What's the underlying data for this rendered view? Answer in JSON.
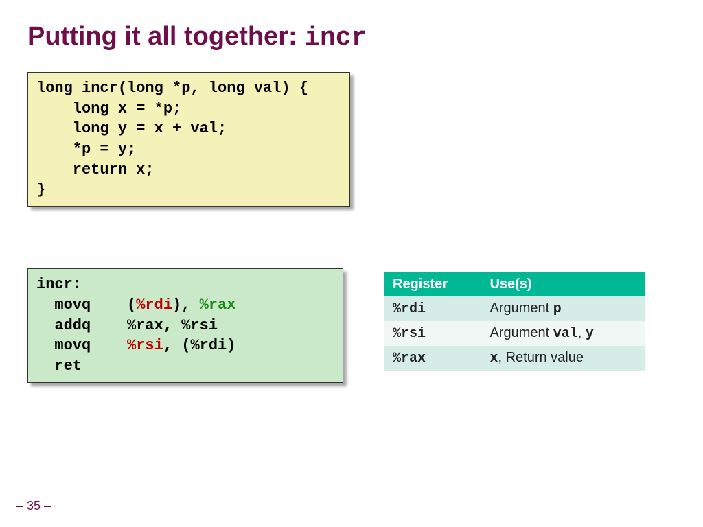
{
  "title": {
    "prefix": "Putting it all together: ",
    "mono": "incr"
  },
  "c_code": "long incr(long *p, long val) {\n    long x = *p;\n    long y = x + val;\n    *p = y;\n    return x;\n}",
  "asm": {
    "label": "incr:",
    "l1": {
      "op": "  movq    ",
      "p1": "(",
      "r1": "%rdi",
      "p2": "), ",
      "r2": "%rax"
    },
    "l2": {
      "op": "  addq    ",
      "a1": "%rax",
      "sep": ", ",
      "a2": "%rsi"
    },
    "l3": {
      "op": "  movq    ",
      "r1": "%rsi",
      "sep": ", ",
      "p1": "(%rdi)"
    },
    "l4": "  ret"
  },
  "table": {
    "h1": "Register",
    "h2": "Use(s)",
    "rows": [
      {
        "reg": "%rdi",
        "use_pre": "Argument ",
        "use_b": "p",
        "use_post": ""
      },
      {
        "reg": "%rsi",
        "use_pre": "Argument ",
        "use_b": "val",
        "use_post": ", ",
        "use_b2": "y"
      },
      {
        "reg": "%rax",
        "use_pre": "",
        "use_b": "x",
        "use_post": ", Return value"
      }
    ]
  },
  "pagenum": "– 35 –"
}
